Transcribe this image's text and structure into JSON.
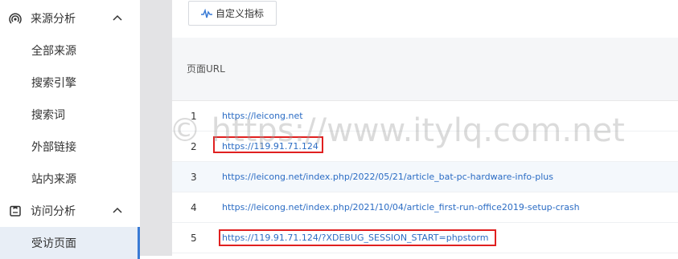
{
  "sidebar": {
    "groups": [
      {
        "label": "来源分析",
        "icon": "broadcast-icon",
        "expanded": true,
        "items": [
          "全部来源",
          "搜索引擎",
          "搜索词",
          "外部链接",
          "站内来源"
        ]
      },
      {
        "label": "访问分析",
        "icon": "visit-analysis-icon",
        "expanded": true,
        "items": [
          "受访页面"
        ],
        "active_item": "受访页面"
      }
    ]
  },
  "toolbar": {
    "custom_metric_label": "自定义指标"
  },
  "table": {
    "column_header": "页面URL",
    "rows": [
      {
        "index": "1",
        "url": "https://leicong.net"
      },
      {
        "index": "2",
        "url": "https://119.91.71.124"
      },
      {
        "index": "3",
        "url": "https://leicong.net/index.php/2022/05/21/article_bat-pc-hardware-info-plus"
      },
      {
        "index": "4",
        "url": "https://leicong.net/index.php/2021/10/04/article_first-run-office2019-setup-crash"
      },
      {
        "index": "5",
        "url": "https://119.91.71.124/?XDEBUG_SESSION_START=phpstorm"
      }
    ]
  },
  "watermark": "© https://www.itylq.com.net",
  "colors": {
    "accent": "#3a7bd5",
    "link": "#2b6cc4",
    "highlight": "#e02020",
    "active_bg": "#e8eef6"
  }
}
